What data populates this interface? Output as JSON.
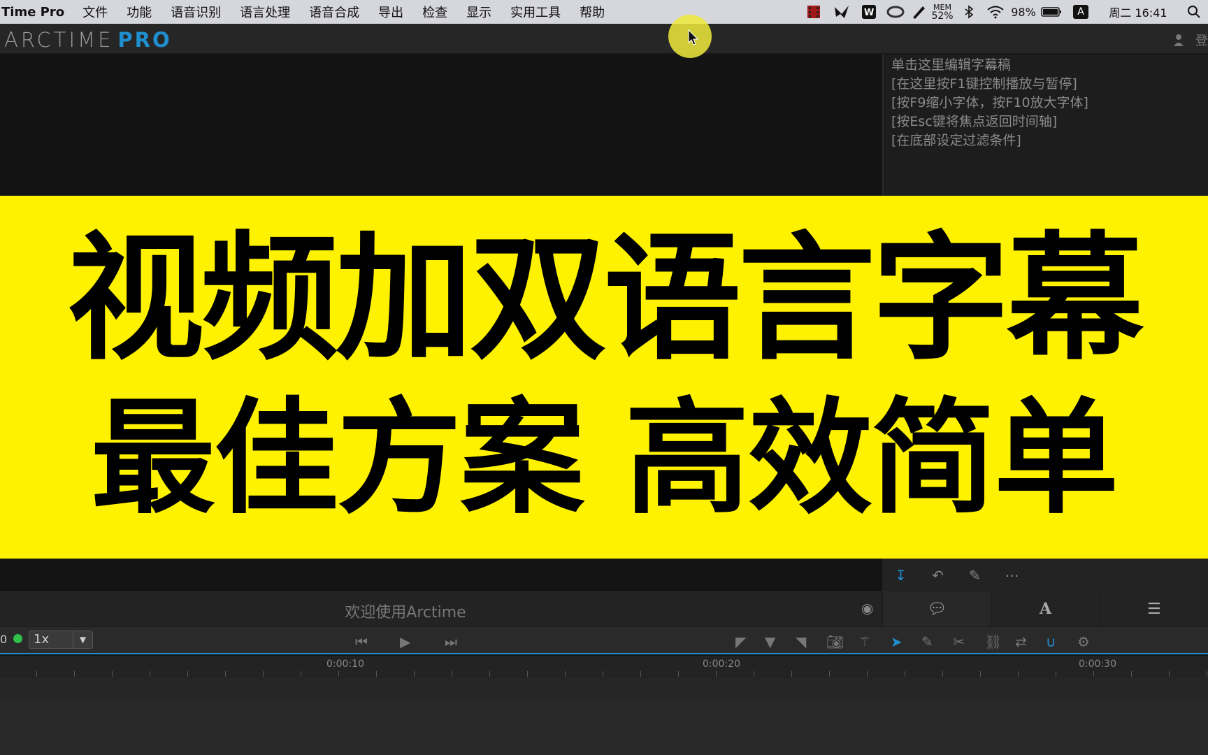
{
  "menubar": {
    "app_name": "Time Pro",
    "items": [
      "文件",
      "功能",
      "语音识别",
      "语言处理",
      "语音合成",
      "导出",
      "检查",
      "显示",
      "实用工具",
      "帮助"
    ],
    "status": {
      "mem_label": "MEM",
      "mem_value": "52%",
      "battery": "98%",
      "input_method": "A",
      "clock": "周二 16:41"
    }
  },
  "app": {
    "logo_main": "ARCTIME",
    "logo_pro": "PRO",
    "login_label": "登"
  },
  "subtitle_panel": {
    "hints": [
      "单击这里编辑字幕稿",
      "[在这里按F1键控制播放与暂停]",
      "[按F9缩小字体，按F10放大字体]",
      "[按Esc键将焦点返回时间轴]",
      "[在底部设定过滤条件]"
    ]
  },
  "banner": {
    "line1": "视频加双语言字幕",
    "line2": "最佳方案 高效简单"
  },
  "welcome": "欢迎使用Arctime",
  "transport": {
    "counter": "0",
    "speed": "1x"
  },
  "ruler": {
    "labels": [
      "0:00:10",
      "0:00:20",
      "0:00:30"
    ]
  },
  "colors": {
    "accent": "#1f8fd0",
    "banner": "#fff200"
  }
}
